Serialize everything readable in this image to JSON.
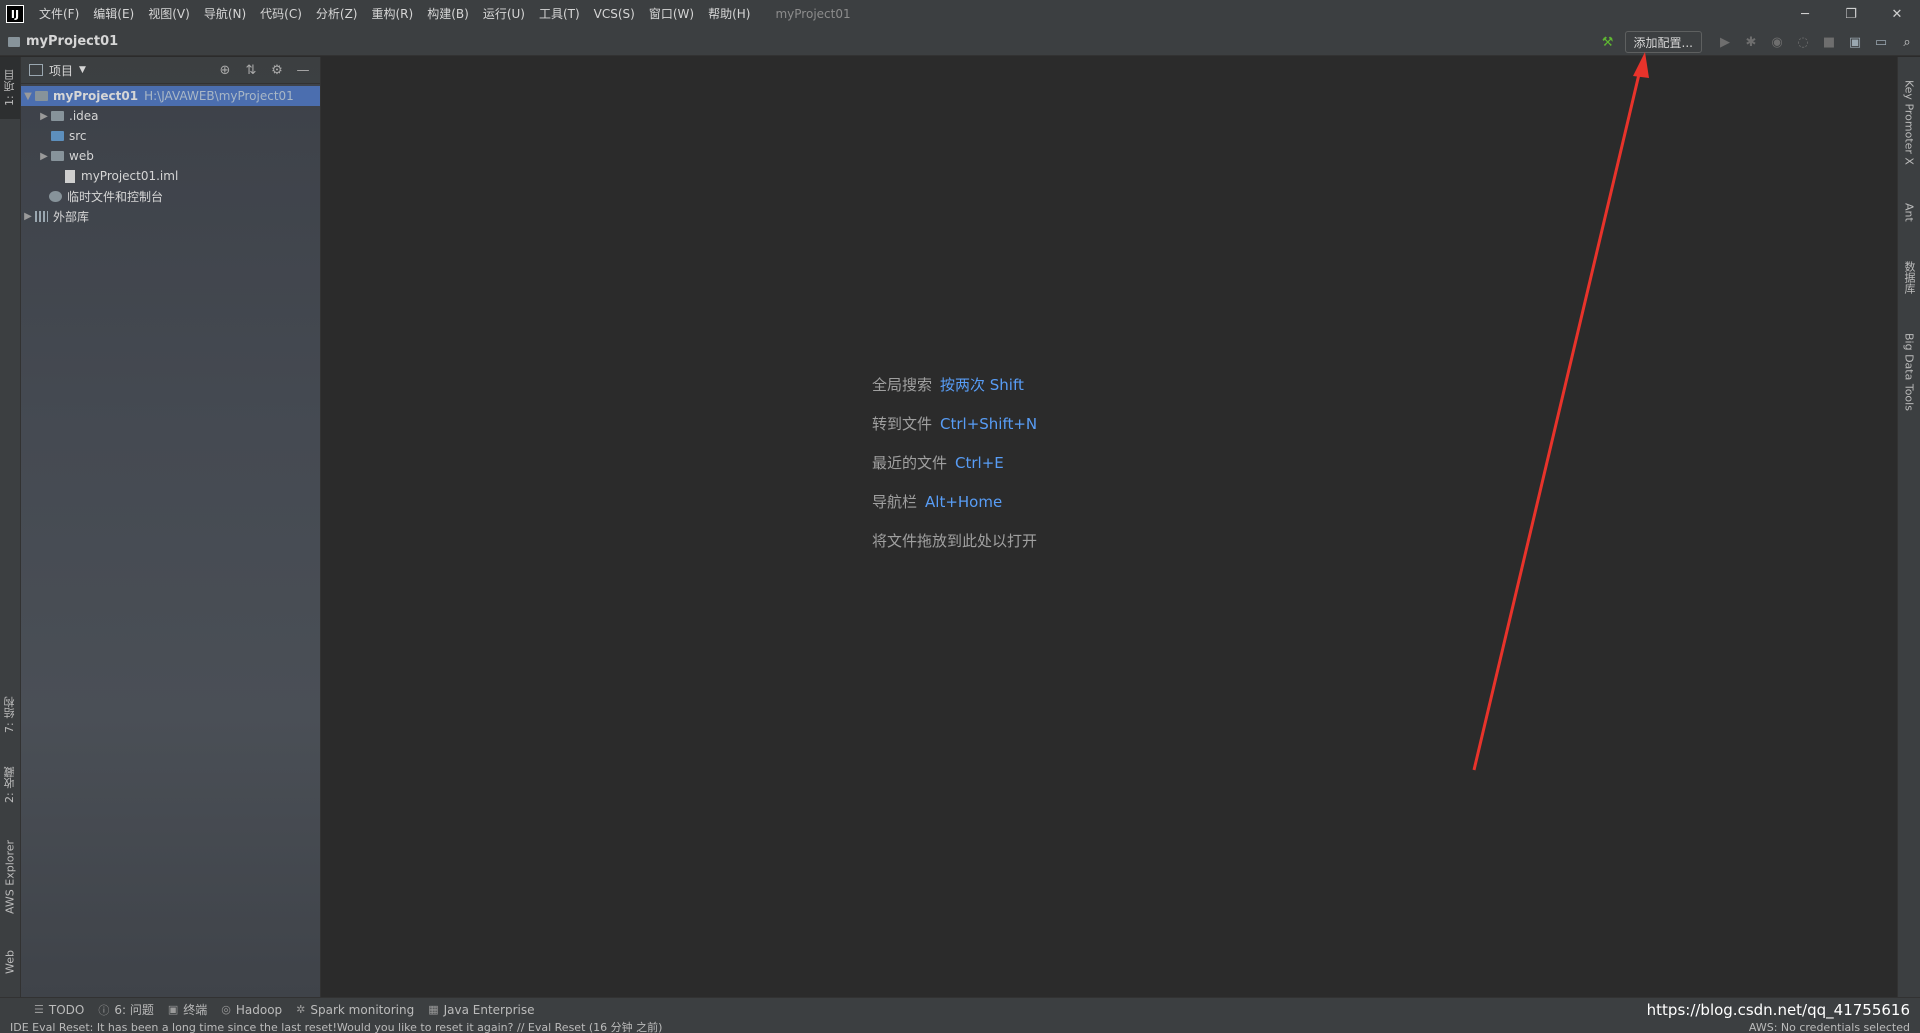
{
  "titlebar": {
    "menu": [
      "文件(F)",
      "编辑(E)",
      "视图(V)",
      "导航(N)",
      "代码(C)",
      "分析(Z)",
      "重构(R)",
      "构建(B)",
      "运行(U)",
      "工具(T)",
      "VCS(S)",
      "窗口(W)",
      "帮助(H)"
    ],
    "window_title": "myProject01"
  },
  "navbar": {
    "project_name": "myProject01",
    "add_config_label": "添加配置..."
  },
  "left_strip": {
    "project_tab": "1: 项目",
    "structure_tab": "7: 结构",
    "favorites_tab": "2: 收藏",
    "aws_tab": "AWS Explorer",
    "web_tab": "Web"
  },
  "right_strip": {
    "key_promoter": "Key Promoter X",
    "ant": "Ant",
    "database": "数据库",
    "big_data": "Big Data Tools"
  },
  "project_panel": {
    "title": "项目",
    "tree": {
      "root_name": "myProject01",
      "root_path": "H:\\JAVAWEB\\myProject01",
      "idea": ".idea",
      "src": "src",
      "web": "web",
      "iml": "myProject01.iml",
      "scratches": "临时文件和控制台",
      "ext_libs": "外部库"
    }
  },
  "editor": {
    "hints": [
      {
        "label": "全局搜索",
        "shortcut": "按两次 Shift"
      },
      {
        "label": "转到文件",
        "shortcut": "Ctrl+Shift+N"
      },
      {
        "label": "最近的文件",
        "shortcut": "Ctrl+E"
      },
      {
        "label": "导航栏",
        "shortcut": "Alt+Home"
      },
      {
        "label": "将文件拖放到此处以打开",
        "shortcut": ""
      }
    ]
  },
  "bottom_tabs": {
    "todo": "TODO",
    "problems": "6: 问题",
    "terminal": "终端",
    "hadoop": "Hadoop",
    "spark": "Spark monitoring",
    "java_ee": "Java Enterprise",
    "watermark": "https://blog.csdn.net/qq_41755616"
  },
  "status": {
    "message": "IDE Eval Reset: It has been a long time since the last reset!Would you like to reset it again? // Eval Reset (16 分钟 之前)",
    "aws": "AWS: No credentials selected"
  },
  "colors": {
    "accent_arrow": "#e8332b",
    "shortcut_blue": "#589df6",
    "selection": "#4b6eaf"
  }
}
